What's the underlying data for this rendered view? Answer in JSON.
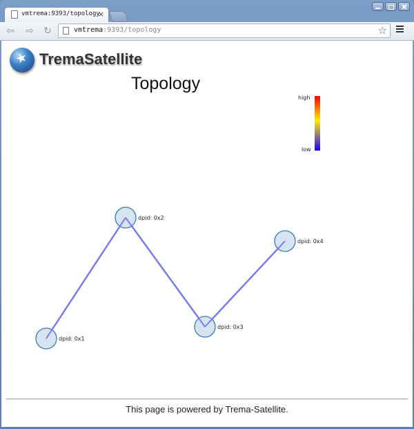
{
  "browser": {
    "tab_title": "vmtrema:9393/topology",
    "tab_close_glyph": "×",
    "url_host": "vmtrema",
    "url_path": ":9393/topology",
    "star_glyph": "☆",
    "icons": [
      "back-icon",
      "forward-icon",
      "reload-icon",
      "page-icon",
      "star-icon",
      "menu-icon",
      "minimize-icon",
      "maximize-icon",
      "close-icon"
    ]
  },
  "page": {
    "brand": "TremaSatellite",
    "title": "Topology",
    "legend": {
      "high": "high",
      "low": "low",
      "colors": [
        "#ff0000",
        "#ffee00",
        "#1a00ff"
      ]
    },
    "footer": "This page is powered by Trema-Satellite."
  },
  "topology": {
    "nodes": [
      {
        "id": "0x1",
        "label": "dpid: 0x1"
      },
      {
        "id": "0x2",
        "label": "dpid: 0x2"
      },
      {
        "id": "0x3",
        "label": "dpid: 0x3"
      },
      {
        "id": "0x4",
        "label": "dpid: 0x4"
      }
    ],
    "links": [
      {
        "source": "0x1",
        "target": "0x2"
      },
      {
        "source": "0x2",
        "target": "0x3"
      },
      {
        "source": "0x3",
        "target": "0x4"
      }
    ],
    "node_fill": "#d6e4f1",
    "node_stroke": "#3a7bb0",
    "link_color": "#7b7bf0"
  }
}
